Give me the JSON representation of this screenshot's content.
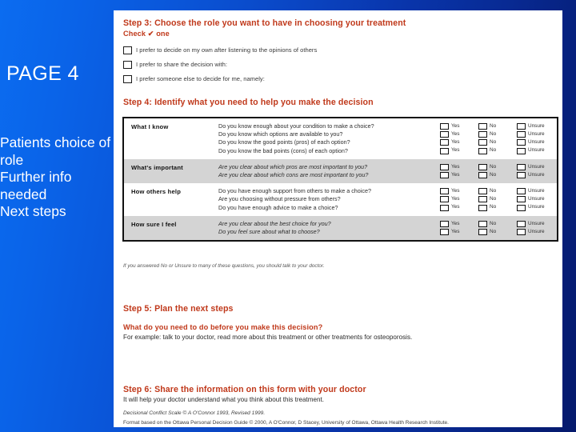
{
  "slide": {
    "page_title": "PAGE 4",
    "bullets": [
      "Patients choice of role",
      "Further info needed",
      "Next steps"
    ],
    "accent_color": "#c0391b",
    "background_from": "#0b6cf0",
    "background_to": "#05196c"
  },
  "document": {
    "step3": {
      "heading": "Step 3: Choose the role you want to have in choosing your treatment",
      "subheading_before": "Check",
      "tick_glyph": "✔",
      "subheading_after": "one",
      "options": [
        "I prefer to decide on my own after listening to the opinions of others",
        "I prefer to share the decision with:",
        "I prefer someone else to decide for me, namely:"
      ]
    },
    "step4": {
      "heading": "Step 4: Identify what you need to help you make the decision",
      "answer_labels": [
        "Yes",
        "No",
        "Unsure"
      ],
      "rows": [
        {
          "category": "What I know",
          "shaded": false,
          "questions": [
            "Do you know enough about your condition to make a choice?",
            "Do you know which options are available to you?",
            "Do you know the good points (pros) of each option?",
            "Do you know the bad points (cons) of each option?"
          ]
        },
        {
          "category": "What's important",
          "shaded": true,
          "questions": [
            "Are you clear about which pros are most important to you?",
            "Are you clear about which cons are most important to you?"
          ]
        },
        {
          "category": "How others help",
          "shaded": false,
          "questions": [
            "Do you have enough support from others to make a choice?",
            "Are you choosing without pressure from others?",
            "Do you have enough advice to make a choice?"
          ]
        },
        {
          "category": "How sure I feel",
          "shaded": true,
          "questions": [
            "Are you clear about the best choice for you?",
            "Do you feel sure about what to choose?"
          ]
        }
      ],
      "note": "If you answered No or Unsure to many of these questions, you should talk to your doctor."
    },
    "step5": {
      "heading": "Step 5: Plan the next steps",
      "question": "What do you need to do before you make this decision?",
      "example": "For example: talk to your doctor, read more about this treatment or other treatments for osteoporosis."
    },
    "step6": {
      "heading": "Step 6: Share the information on this form with your doctor",
      "subtext": "It will help your doctor understand what you think about this treatment."
    },
    "footer": {
      "line1": "Decisional Conflict Scale  ©  A O'Connor 1993, Revised 1999.",
      "line2": "Format based on the Ottawa Personal Decision Guide © 2000, A O'Connor, D Stacey, University of Ottawa, Ottawa Health Research Institute."
    }
  }
}
